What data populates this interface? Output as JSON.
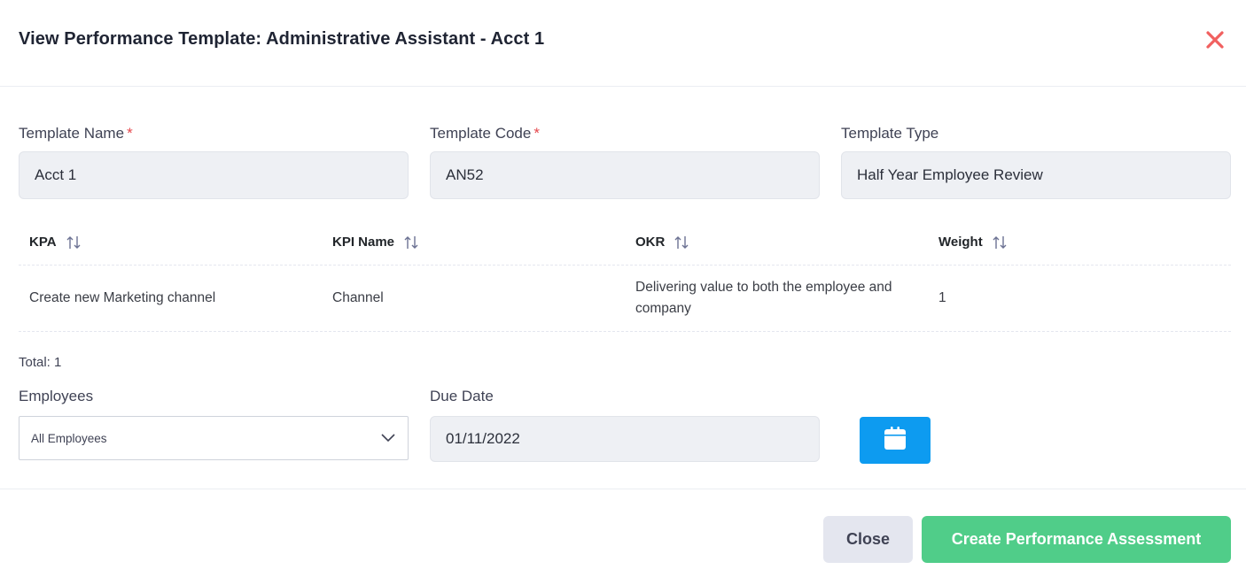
{
  "modal": {
    "title": "View Performance Template: Administrative Assistant - Acct 1",
    "close_icon": "close-icon",
    "accent_color": "#f1605f"
  },
  "form": {
    "template_name": {
      "label": "Template Name",
      "required_mark": "*",
      "value": "Acct 1"
    },
    "template_code": {
      "label": "Template Code",
      "required_mark": "*",
      "value": "AN52"
    },
    "template_type": {
      "label": "Template Type",
      "value": "Half Year Employee Review"
    }
  },
  "table": {
    "columns": [
      {
        "label": "KPA",
        "sort_icon": "sort-icon"
      },
      {
        "label": "KPI Name",
        "sort_icon": "sort-icon"
      },
      {
        "label": "OKR",
        "sort_icon": "sort-icon"
      },
      {
        "label": "Weight",
        "sort_icon": "sort-icon"
      }
    ],
    "rows": [
      {
        "kpa": "Create new Marketing channel",
        "kpi_name": "Channel",
        "okr": "Delivering value to both the employee and company",
        "weight": "1"
      }
    ],
    "total_label": "Total: 1"
  },
  "assessment": {
    "employees": {
      "label": "Employees",
      "selected": "All Employees"
    },
    "due_date": {
      "label": "Due Date",
      "value": "01/11/2022"
    },
    "calendar_icon": "calendar-icon",
    "calendar_button_color": "#0d9bf0"
  },
  "footer": {
    "close_label": "Close",
    "create_label": "Create Performance Assessment",
    "create_color": "#50cd89"
  }
}
